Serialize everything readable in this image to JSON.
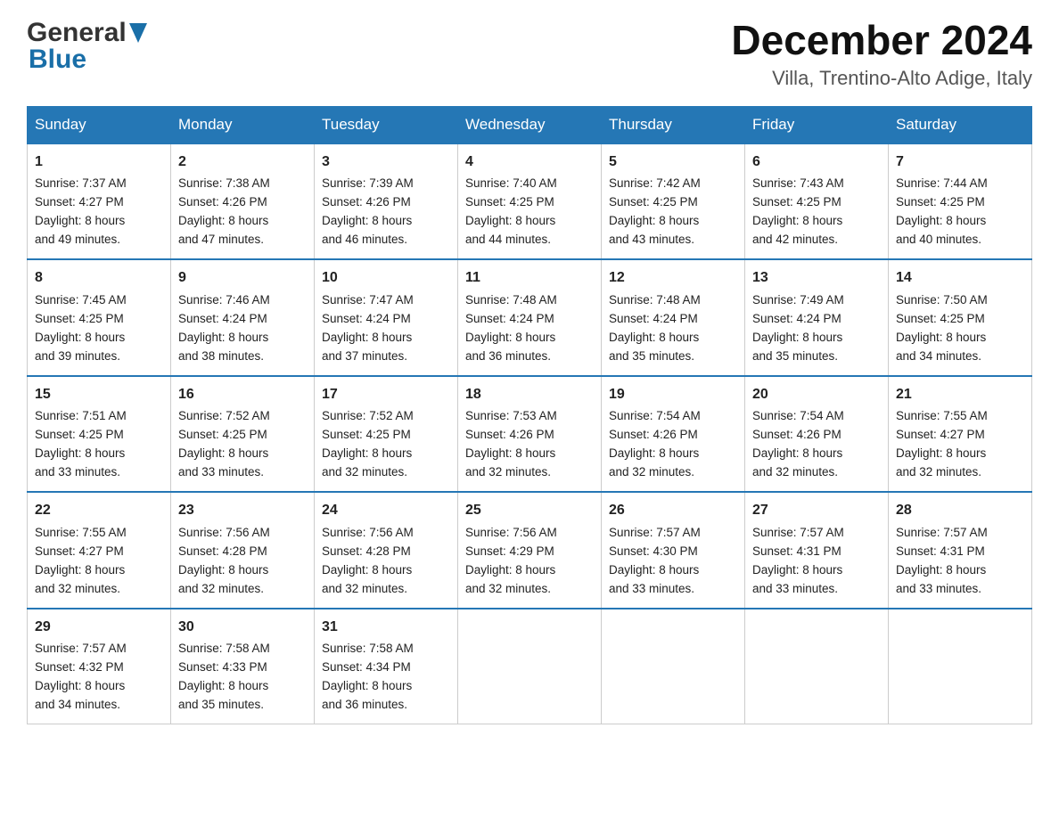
{
  "header": {
    "logo_general": "General",
    "logo_blue": "Blue",
    "month_year": "December 2024",
    "location": "Villa, Trentino-Alto Adige, Italy"
  },
  "days_of_week": [
    "Sunday",
    "Monday",
    "Tuesday",
    "Wednesday",
    "Thursday",
    "Friday",
    "Saturday"
  ],
  "weeks": [
    [
      {
        "day": "1",
        "sunrise": "7:37 AM",
        "sunset": "4:27 PM",
        "daylight": "8 hours and 49 minutes."
      },
      {
        "day": "2",
        "sunrise": "7:38 AM",
        "sunset": "4:26 PM",
        "daylight": "8 hours and 47 minutes."
      },
      {
        "day": "3",
        "sunrise": "7:39 AM",
        "sunset": "4:26 PM",
        "daylight": "8 hours and 46 minutes."
      },
      {
        "day": "4",
        "sunrise": "7:40 AM",
        "sunset": "4:25 PM",
        "daylight": "8 hours and 44 minutes."
      },
      {
        "day": "5",
        "sunrise": "7:42 AM",
        "sunset": "4:25 PM",
        "daylight": "8 hours and 43 minutes."
      },
      {
        "day": "6",
        "sunrise": "7:43 AM",
        "sunset": "4:25 PM",
        "daylight": "8 hours and 42 minutes."
      },
      {
        "day": "7",
        "sunrise": "7:44 AM",
        "sunset": "4:25 PM",
        "daylight": "8 hours and 40 minutes."
      }
    ],
    [
      {
        "day": "8",
        "sunrise": "7:45 AM",
        "sunset": "4:25 PM",
        "daylight": "8 hours and 39 minutes."
      },
      {
        "day": "9",
        "sunrise": "7:46 AM",
        "sunset": "4:24 PM",
        "daylight": "8 hours and 38 minutes."
      },
      {
        "day": "10",
        "sunrise": "7:47 AM",
        "sunset": "4:24 PM",
        "daylight": "8 hours and 37 minutes."
      },
      {
        "day": "11",
        "sunrise": "7:48 AM",
        "sunset": "4:24 PM",
        "daylight": "8 hours and 36 minutes."
      },
      {
        "day": "12",
        "sunrise": "7:48 AM",
        "sunset": "4:24 PM",
        "daylight": "8 hours and 35 minutes."
      },
      {
        "day": "13",
        "sunrise": "7:49 AM",
        "sunset": "4:24 PM",
        "daylight": "8 hours and 35 minutes."
      },
      {
        "day": "14",
        "sunrise": "7:50 AM",
        "sunset": "4:25 PM",
        "daylight": "8 hours and 34 minutes."
      }
    ],
    [
      {
        "day": "15",
        "sunrise": "7:51 AM",
        "sunset": "4:25 PM",
        "daylight": "8 hours and 33 minutes."
      },
      {
        "day": "16",
        "sunrise": "7:52 AM",
        "sunset": "4:25 PM",
        "daylight": "8 hours and 33 minutes."
      },
      {
        "day": "17",
        "sunrise": "7:52 AM",
        "sunset": "4:25 PM",
        "daylight": "8 hours and 32 minutes."
      },
      {
        "day": "18",
        "sunrise": "7:53 AM",
        "sunset": "4:26 PM",
        "daylight": "8 hours and 32 minutes."
      },
      {
        "day": "19",
        "sunrise": "7:54 AM",
        "sunset": "4:26 PM",
        "daylight": "8 hours and 32 minutes."
      },
      {
        "day": "20",
        "sunrise": "7:54 AM",
        "sunset": "4:26 PM",
        "daylight": "8 hours and 32 minutes."
      },
      {
        "day": "21",
        "sunrise": "7:55 AM",
        "sunset": "4:27 PM",
        "daylight": "8 hours and 32 minutes."
      }
    ],
    [
      {
        "day": "22",
        "sunrise": "7:55 AM",
        "sunset": "4:27 PM",
        "daylight": "8 hours and 32 minutes."
      },
      {
        "day": "23",
        "sunrise": "7:56 AM",
        "sunset": "4:28 PM",
        "daylight": "8 hours and 32 minutes."
      },
      {
        "day": "24",
        "sunrise": "7:56 AM",
        "sunset": "4:28 PM",
        "daylight": "8 hours and 32 minutes."
      },
      {
        "day": "25",
        "sunrise": "7:56 AM",
        "sunset": "4:29 PM",
        "daylight": "8 hours and 32 minutes."
      },
      {
        "day": "26",
        "sunrise": "7:57 AM",
        "sunset": "4:30 PM",
        "daylight": "8 hours and 33 minutes."
      },
      {
        "day": "27",
        "sunrise": "7:57 AM",
        "sunset": "4:31 PM",
        "daylight": "8 hours and 33 minutes."
      },
      {
        "day": "28",
        "sunrise": "7:57 AM",
        "sunset": "4:31 PM",
        "daylight": "8 hours and 33 minutes."
      }
    ],
    [
      {
        "day": "29",
        "sunrise": "7:57 AM",
        "sunset": "4:32 PM",
        "daylight": "8 hours and 34 minutes."
      },
      {
        "day": "30",
        "sunrise": "7:58 AM",
        "sunset": "4:33 PM",
        "daylight": "8 hours and 35 minutes."
      },
      {
        "day": "31",
        "sunrise": "7:58 AM",
        "sunset": "4:34 PM",
        "daylight": "8 hours and 36 minutes."
      },
      null,
      null,
      null,
      null
    ]
  ],
  "labels": {
    "sunrise": "Sunrise:",
    "sunset": "Sunset:",
    "daylight": "Daylight:"
  }
}
